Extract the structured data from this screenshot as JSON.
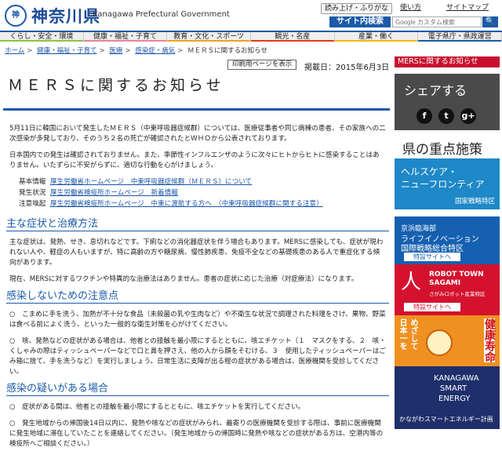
{
  "header": {
    "logo_char": "神",
    "site_name": "神奈川県",
    "site_sub": "Kanagawa Prefectural Government",
    "util_links": [
      "読み上げ・ふりがな",
      "使い方",
      "サイトマップ"
    ],
    "search_label": "サイト内検索",
    "search_placeholder": "Google カスタム検索",
    "search_button": "🔍"
  },
  "nav": {
    "items": [
      {
        "label": "くらし・安全・環境",
        "color": "#8cc63e"
      },
      {
        "label": "健康・福祉・子育て",
        "color": "#e8839a"
      },
      {
        "label": "教育・文化・スポーツ",
        "color": "#f0a020"
      },
      {
        "label": "観光・名産",
        "color": "#e8381a"
      },
      {
        "label": "産業・働く",
        "color": "#f0b800"
      },
      {
        "label": "電子県庁・県政運営",
        "color": "#1a5aa8"
      }
    ]
  },
  "breadcrumb": [
    "ホーム",
    "健康・福祉・子育て",
    "医療",
    "感染症・病気",
    "ＭＥＲＳに関するお知らせ"
  ],
  "main": {
    "print_label": "印刷用ページを表示",
    "date": "掲載日：2015年6月3日",
    "title": "ＭＥＲＳに関するお知らせ",
    "intro1": "5月11日に韓国において発生したＭＥＲＳ（中東呼吸器症候群）については、医療従事者や同じ病棟の患者、その家族への二次感染が多発しており、そのうち２名の死亡が確認されたとＷＨＯから公表されております。",
    "intro2": "日本国内での発生は確認されておりません。また、季節性インフルエンザのように次々にヒトからヒトに感染することはありません。いたずらに不安がらずに、適切な行動を心がけましょう。",
    "links": [
      {
        "label": "基本情報",
        "text": "厚生労働省ホームページ　中東呼吸器症候群（ＭＥＲＳ）について"
      },
      {
        "label": "発生状況",
        "text": "厚生労働省検疫所ホームページ　新着情報"
      },
      {
        "label": "注意喚起",
        "text": "厚生労働省検疫所ホームページ　中東に渡航する方へ　〈中東呼吸器症候群に関する注意〉"
      }
    ],
    "sec1_title": "主な症状と治療方法",
    "sec1_p1": "主な症状は、発熱、せき、息切れなどです。下痢などの消化器症状を伴う場合もあります。MERSに感染しても、症状が現われない人や、軽症の人もいますが、特に高齢の方や糖尿病、慢性肺疾患、免疫不全などの基礎疾患のある人で重症化する傾向があります。",
    "sec1_p2": "現在、MERSに対するワクチンや特異的な治療法はありません。患者の症状に応じた治療（対症療法）になります。",
    "sec2_title": "感染しないための注意点",
    "sec2_p1": "○　こまめに手を洗う、加熱が不十分な食品（未殺菌の乳や生肉など）や不衛生な状況で調理された料理をさけ、果物、野菜は食べる前によく洗う、といった一般的な衛生対策を心がけてください。",
    "sec2_p2": "○　咳、発熱などの症状がある場合は、他者との接触を最小限にするとともに、咳エチケット（１　マスクをする、２　咳・くしゃみの際はティッシュペーパーなどで口と鼻を押さえ、他の人から顔をそむける、３　使用したティッシュペーパーはごみ箱に捨て、手を洗うなど）を実行しましょう。日常生活に支障が出る程の症状がある場合は、医療機関を受診してください。",
    "sec3_title": "感染の疑いがある場合",
    "sec3_p1": "○　症状がある間は、他者との接触を最小限にするとともに、咳エチケットを実行してください。",
    "sec3_p2": "○　発生地域からの帰国後14日以内に、発熱や咳などの症状がみられ、最寄りの医療機関を受診する際は、事前に医療機関に発生地域に滞在していたことを連絡してください。（発生地域からの帰国時に発熱や咳などの症状がある方は、空港内等の検疫所へご相談ください。）"
  },
  "sidebar": {
    "top_link": "MERSに関するお知らせ",
    "share_title": "シェアする",
    "share_icons": [
      "f",
      "t",
      "g+"
    ],
    "focus_title": "県の重点施策",
    "banner1": {
      "t1": "ヘルスケア・",
      "t2": "ニューフロンティア",
      "t3": "国家戦略特区"
    },
    "banner2": {
      "t1": "京浜臨海部",
      "t2": "ライフイノベーション",
      "t3": "国際戦略総合特区",
      "btn": "特設サイトへ"
    },
    "banner3": {
      "mark": "人",
      "t1": "ROBOT TOWN",
      "t2": "SAGAMI",
      "t3": "さがみロボット産業特区",
      "btn": "特設サイトへ"
    },
    "banner4": {
      "v1": "日本一を",
      "v2": "めざして",
      "v3": "健康寿命"
    },
    "banner5": {
      "t1": "KANAGAWA",
      "t2": "SMART",
      "t3": "ENERGY",
      "t4": "かながわスマートエネルギー計画"
    }
  }
}
